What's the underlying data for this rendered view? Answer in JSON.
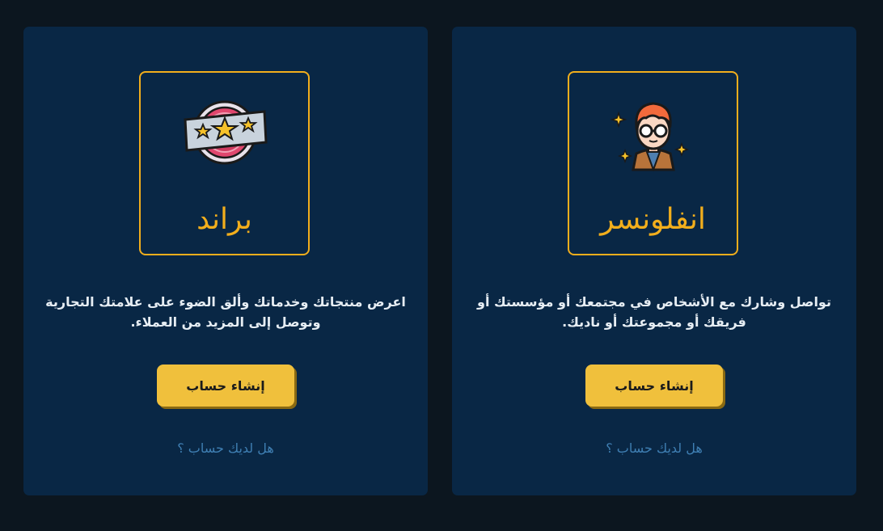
{
  "cards": {
    "brand": {
      "title": "براند",
      "description": "اعرض منتجاتك وخدماتك وألق الضوء على علامتك التجارية وتوصل إلى المزيد من العملاء.",
      "button_label": "إنشاء حساب",
      "login_link": "هل لديك حساب ؟",
      "icon": "rating-badge-icon"
    },
    "influencer": {
      "title": "انفلونسر",
      "description": "تواصل وشارك مع الأشخاص في مجتمعك أو مؤسستك أو فريقك أو مجموعتك أو ناديك.",
      "button_label": "إنشاء حساب",
      "login_link": "هل لديك حساب ؟",
      "icon": "influencer-avatar-icon"
    }
  },
  "colors": {
    "background": "#0c161f",
    "card": "#092745",
    "accent": "#f2ae1c",
    "button": "#f0c03c",
    "link": "#3f7fb3"
  }
}
